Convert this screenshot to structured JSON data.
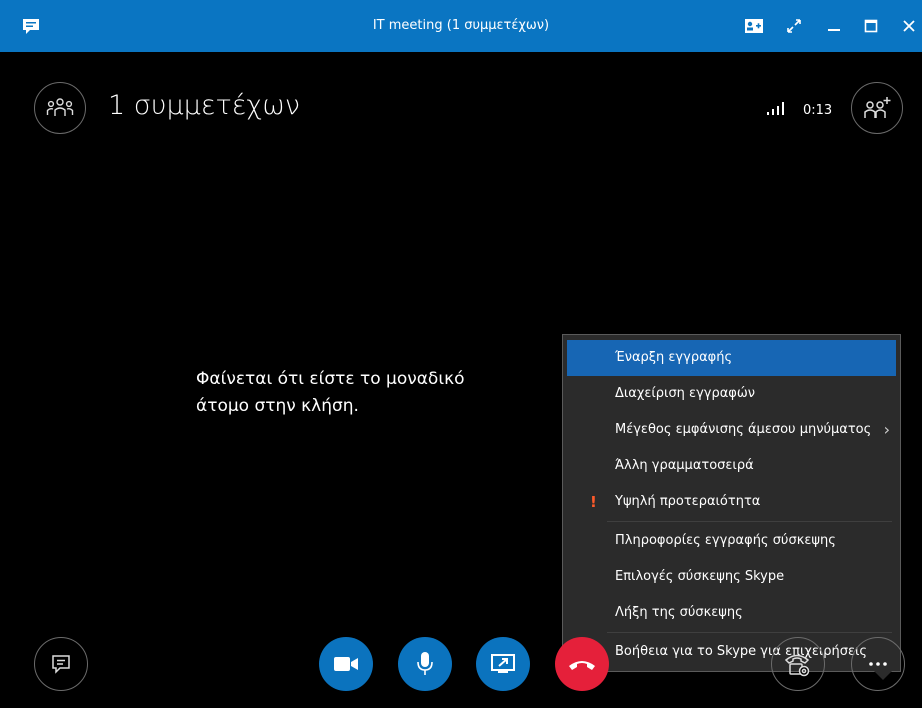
{
  "window": {
    "title": "IT meeting (1 συμμετέχων)"
  },
  "header": {
    "participants_label": "1 συμμετέχων",
    "call_timer": "0:13"
  },
  "main": {
    "message_line1": "Φαίνεται ότι είστε το μοναδικό",
    "message_line2": "άτομο στην κλήση."
  },
  "menu": {
    "items": [
      {
        "label": "Έναρξη εγγραφής",
        "selected": true
      },
      {
        "label": "Διαχείριση εγγραφών"
      },
      {
        "label": "Μέγεθος εμφάνισης άμεσου μηνύματος",
        "submenu": true
      },
      {
        "label": "Άλλη γραμματοσειρά"
      },
      {
        "label": "Υψηλή προτεραιότητα",
        "icon": "exclamation-icon"
      },
      {
        "label": "Πληροφορίες εγγραφής σύσκεψης"
      },
      {
        "label": "Επιλογές σύσκεψης Skype"
      },
      {
        "label": "Λήξη της σύσκεψης"
      },
      {
        "label": "Βοήθεια για το Skype για επιχειρήσεις"
      }
    ]
  },
  "controls": {
    "buttons": [
      "chat-icon",
      "video-icon",
      "microphone-icon",
      "share-screen-icon",
      "hang-up-icon",
      "call-controls-icon",
      "more-options-icon"
    ]
  },
  "colors": {
    "titlebar": "#0a75c2",
    "accent_blue": "#0b73be",
    "hang_up_red": "#e5203a",
    "menu_bg": "#2b2b2b",
    "menu_selected": "#1766b4",
    "priority_orange": "#ff5a2a"
  }
}
